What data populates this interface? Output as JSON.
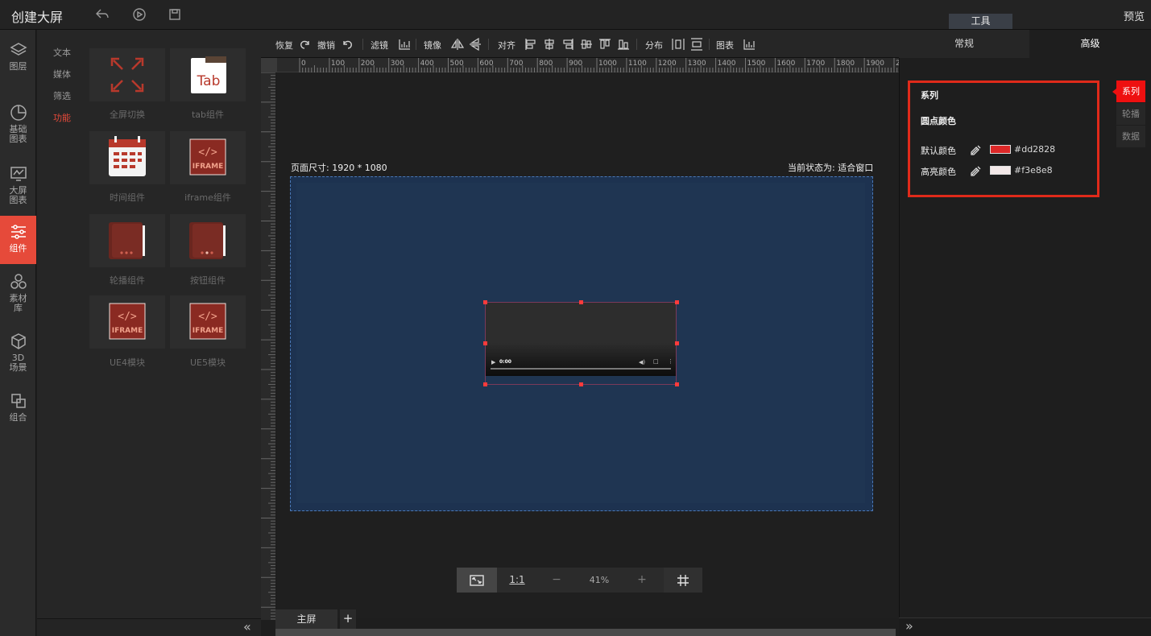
{
  "app": {
    "title": "创建大屏",
    "preview": "预览"
  },
  "toolbox_tab": "工具",
  "left_nav": [
    {
      "label": "图层",
      "icon": "layers-icon"
    },
    {
      "label": "基础图表",
      "line1": "基础",
      "line2": "图表",
      "icon": "pie-chart-icon"
    },
    {
      "label": "大屏图表",
      "line1": "大屏",
      "line2": "图表",
      "icon": "monitor-chart-icon"
    },
    {
      "label": "组件",
      "icon": "sliders-icon",
      "active": true
    },
    {
      "label": "素材库",
      "line1": "素材",
      "line2": "库",
      "icon": "hexagons-icon"
    },
    {
      "label": "3D场景",
      "line1": "3D",
      "line2": "场景",
      "icon": "cube-icon"
    },
    {
      "label": "组合",
      "icon": "group-icon"
    }
  ],
  "sub_nav": [
    {
      "label": "文本"
    },
    {
      "label": "媒体"
    },
    {
      "label": "筛选"
    },
    {
      "label": "功能",
      "active": true
    }
  ],
  "components": [
    {
      "label": "全屏切换",
      "icon": "fullscreen-icon"
    },
    {
      "label": "tab组件",
      "icon": "tab-icon",
      "icon_text": "Tab"
    },
    {
      "label": "时间组件",
      "icon": "calendar-icon"
    },
    {
      "label": "iframe组件",
      "icon": "iframe-icon",
      "icon_text": "IFRAME"
    },
    {
      "label": "轮播组件",
      "icon": "carousel-icon"
    },
    {
      "label": "按钮组件",
      "icon": "button-component-icon"
    },
    {
      "label": "UE4模块",
      "icon": "ue4-iframe-icon",
      "icon_text": "IFRAME"
    },
    {
      "label": "UE5模块",
      "icon": "ue5-iframe-icon",
      "icon_text": "IFRAME"
    }
  ],
  "toolbar": {
    "redo": "恢复",
    "undo": "撤销",
    "filter": "滤镜",
    "mirror": "镜像",
    "align": "对齐",
    "distribute": "分布",
    "chart": "图表"
  },
  "ruler": {
    "h_ticks": [
      "0",
      "100",
      "200",
      "300",
      "400",
      "500",
      "600",
      "700",
      "800",
      "900",
      "1000",
      "1100",
      "1200",
      "1300",
      "1400",
      "1500",
      "1600",
      "1700",
      "1800",
      "1900",
      "20"
    ]
  },
  "canvas": {
    "page_size": "页面尺寸: 1920 * 1080",
    "state": "当前状态为: 适合窗口",
    "video_time": "0:00"
  },
  "zoom": {
    "fit_icon": "fit-screen-icon",
    "one_to_one": "1:1",
    "minus": "−",
    "percent": "41%",
    "plus": "+",
    "grid_icon": "grid-icon"
  },
  "screens": {
    "main": "主屏",
    "add": "+"
  },
  "right_panel": {
    "tabs": {
      "normal": "常规",
      "advanced": "高级"
    },
    "series_title": "系列",
    "dot_color_title": "圆点颜色",
    "default_color_label": "默认颜色",
    "default_color_value": "#dd2828",
    "highlight_color_label": "高亮颜色",
    "highlight_color_value": "#f3e8e8",
    "side_tabs": [
      "系列",
      "轮播",
      "数据"
    ]
  },
  "colors": {
    "accent": "#e64a3a",
    "highlight_border": "#e02a1a",
    "default_color": "#dd2828",
    "highlight_color": "#f3e8e8",
    "screen_bg": "#1d3250"
  }
}
